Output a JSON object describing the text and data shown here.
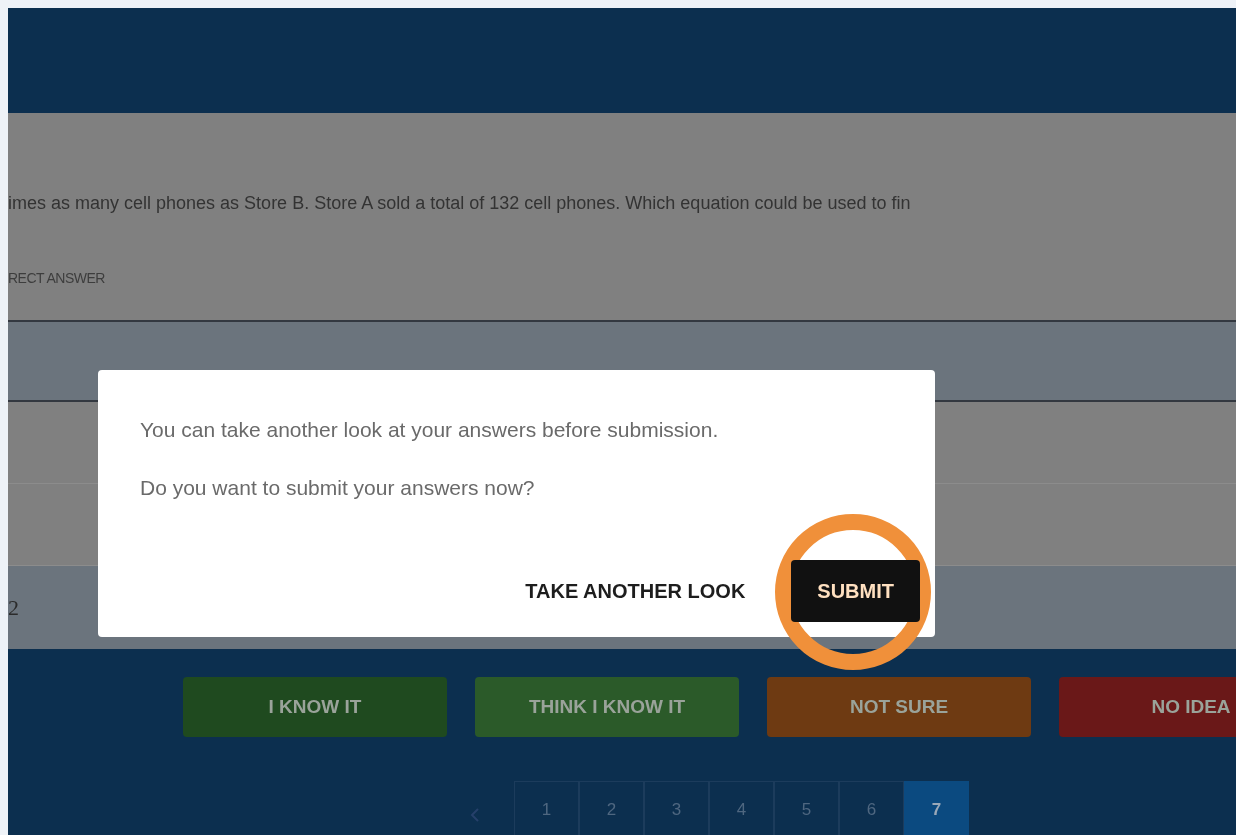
{
  "question": {
    "text": "imes as many cell phones as Store B. Store A sold a total of 132 cell phones. Which equation could be used to fin"
  },
  "answer_header": {
    "label": "RECT ANSWER"
  },
  "answer_rows": [
    {
      "kind": "band"
    },
    {
      "kind": "plain"
    },
    {
      "kind": "plain"
    },
    {
      "kind": "band",
      "label": "2"
    }
  ],
  "dialog": {
    "messages": [
      "You can take another look at your answers before submission.",
      "Do you want to submit your answers now?"
    ],
    "buttons": [
      {
        "kind": "text",
        "label": "TAKE ANOTHER LOOK"
      },
      {
        "kind": "primary",
        "label": "SUBMIT",
        "highlighted": true
      }
    ]
  },
  "confidence_buttons": [
    {
      "label": "I KNOW IT",
      "color": "#1f4a1f"
    },
    {
      "label": "THINK I KNOW IT",
      "color": "#2b5a29"
    },
    {
      "label": "NOT SURE",
      "color": "#6e3a12"
    },
    {
      "label": "NO IDEA",
      "color": "#6a1818"
    }
  ],
  "pagination": {
    "pages": [
      {
        "label": "1",
        "selected": false
      },
      {
        "label": "2",
        "selected": false
      },
      {
        "label": "3",
        "selected": false
      },
      {
        "label": "4",
        "selected": false
      },
      {
        "label": "5",
        "selected": false
      },
      {
        "label": "6",
        "selected": false
      },
      {
        "label": "7",
        "selected": true
      }
    ]
  }
}
